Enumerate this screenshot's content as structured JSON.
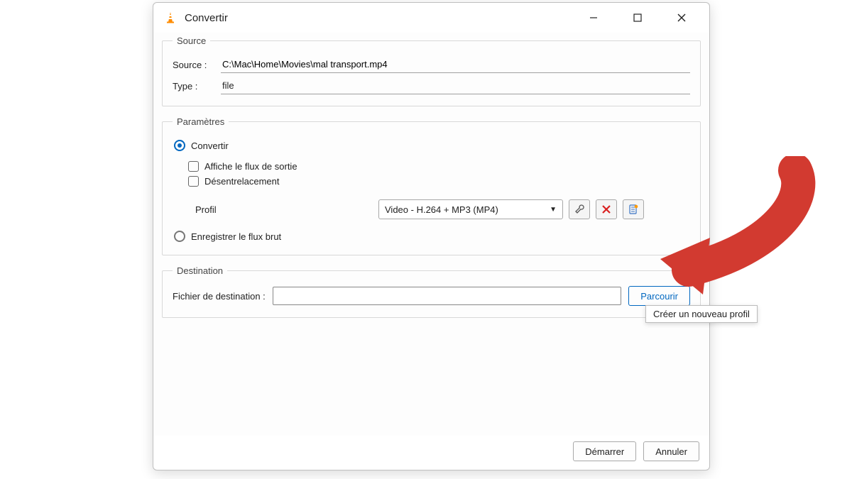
{
  "window": {
    "title": "Convertir"
  },
  "source": {
    "legend": "Source",
    "source_label": "Source :",
    "source_value": "C:\\Mac\\Home\\Movies\\mal transport.mp4",
    "type_label": "Type :",
    "type_value": "file"
  },
  "params": {
    "legend": "Paramètres",
    "convert_label": "Convertir",
    "show_output_label": "Affiche le flux de sortie",
    "deinterlace_label": "Désentrelacement",
    "profile_label": "Profil",
    "profile_value": "Video - H.264 + MP3 (MP4)",
    "dump_raw_label": "Enregistrer le flux brut"
  },
  "destination": {
    "legend": "Destination",
    "dest_label": "Fichier de destination :",
    "dest_value": "",
    "browse_label": "Parcourir"
  },
  "footer": {
    "start": "Démarrer",
    "cancel": "Annuler"
  },
  "tooltip": {
    "text": "Créer un nouveau profil"
  }
}
